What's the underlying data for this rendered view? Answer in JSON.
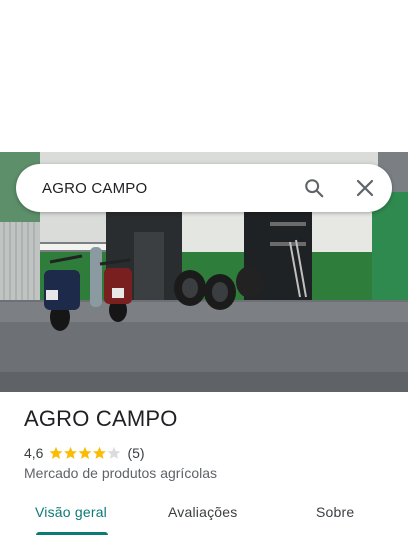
{
  "search": {
    "value": "AGRO CAMPO"
  },
  "place": {
    "name": "AGRO CAMPO",
    "rating": "4,6",
    "stars": 4.6,
    "review_count": "(5)",
    "category": "Mercado de produtos agrícolas"
  },
  "tabs": [
    {
      "label": "Visão geral",
      "active": true
    },
    {
      "label": "Avaliações",
      "active": false
    },
    {
      "label": "Sobre",
      "active": false
    }
  ],
  "colors": {
    "accent": "#0b7a75",
    "star": "#fbbc04"
  },
  "icons": {
    "search": "search-icon",
    "close": "close-icon"
  }
}
